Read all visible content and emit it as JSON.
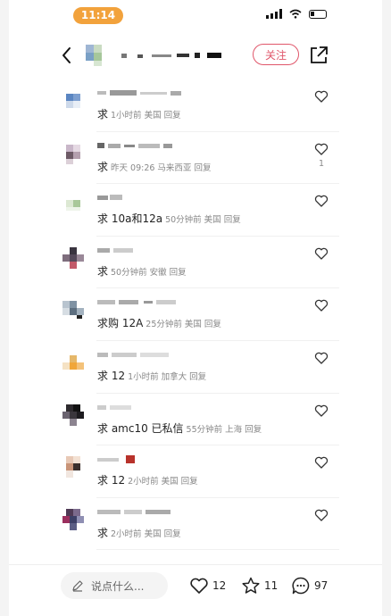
{
  "status_bar": {
    "time": "11:14"
  },
  "header": {
    "follow_label": "关注"
  },
  "comments": [
    {
      "text": "求",
      "meta": "1小时前 美国 回复",
      "likes": ""
    },
    {
      "text": "求",
      "meta": "昨天 09:26 马来西亚 回复",
      "likes": "1"
    },
    {
      "text": "求 10a和12a",
      "meta": "50分钟前 美国 回复",
      "likes": ""
    },
    {
      "text": "求",
      "meta": "50分钟前 安徽 回复",
      "likes": ""
    },
    {
      "text": "求购 12A",
      "meta": "25分钟前 美国 回复",
      "likes": ""
    },
    {
      "text": "求 12",
      "meta": "1小时前 加拿大 回复",
      "likes": ""
    },
    {
      "text": "求 amc10 已私信",
      "meta": "55分钟前 上海 回复",
      "likes": ""
    },
    {
      "text": "求 12",
      "meta": "2小时前 美国 回复",
      "likes": ""
    },
    {
      "text": "求",
      "meta": "2小时前 美国 回复",
      "likes": ""
    }
  ],
  "bottom_bar": {
    "input_placeholder": "说点什么...",
    "like_count": "12",
    "collect_count": "11",
    "comment_count": "97"
  },
  "icons": [
    "back-icon",
    "share-icon",
    "heart-icon",
    "star-icon",
    "comment-icon",
    "pencil-icon"
  ],
  "colors": {
    "accent": "#e0566a",
    "time_pill": "#f2a23c"
  }
}
